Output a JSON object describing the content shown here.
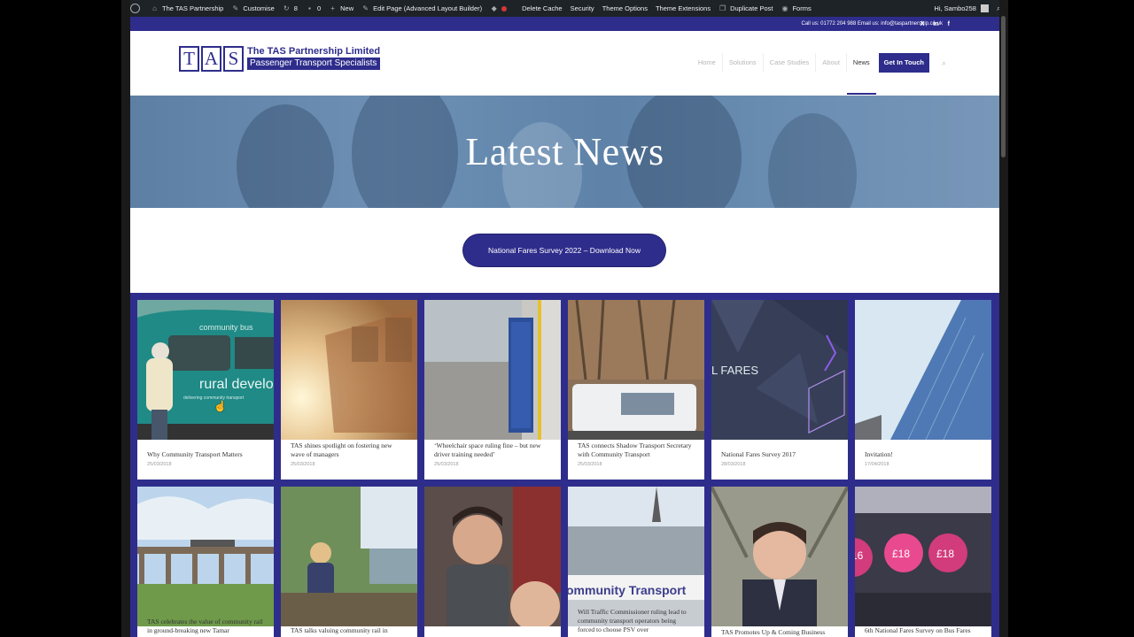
{
  "adminbar": {
    "site_name": "The TAS Partnership",
    "customise": "Customise",
    "updates_count": "8",
    "comments_count": "0",
    "new": "New",
    "edit_page": "Edit Page (Advanced Layout Builder)",
    "delete_cache": "Delete Cache",
    "security": "Security",
    "theme_options": "Theme Options",
    "theme_extensions": "Theme Extensions",
    "duplicate_post": "Duplicate Post",
    "forms": "Forms",
    "greeting": "Hi, Sambo258"
  },
  "topbar": {
    "contact": "Call us: 01772 204 988 Email us: info@taspartnership.co.uk",
    "social_x": "X",
    "social_linkedin": "in",
    "social_facebook": "f"
  },
  "logo": {
    "letters": [
      "T",
      "A",
      "S"
    ],
    "name": "The TAS Partnership Limited",
    "tagline": "Passenger Transport Specialists"
  },
  "nav": {
    "items": [
      "Home",
      "Solutions",
      "Case Studies",
      "About",
      "News"
    ],
    "active": "News",
    "cta": "Get In Touch"
  },
  "hero": {
    "title": "Latest News"
  },
  "download": {
    "label": "National Fares Survey 2022 – Download Now"
  },
  "posts": [
    {
      "title": "Why Community Transport Matters",
      "date": "25/03/2018",
      "image": "community-bus"
    },
    {
      "title": "TAS shines spotlight on fostering new wave of managers",
      "date": "25/03/2018",
      "image": "bus-sunlight"
    },
    {
      "title": "‘Wheelchair space ruling fine – but new driver training needed’",
      "date": "25/03/2018",
      "image": "bus-interior"
    },
    {
      "title": "TAS connects Shadow Transport Secretary with Community Transport",
      "date": "25/03/2018",
      "image": "minibus-trees"
    },
    {
      "title": "National Fares Survey 2017",
      "date": "28/03/2018",
      "image": "fares-graphic"
    },
    {
      "title": "Invitation!",
      "date": "17/04/2018",
      "image": "skyscraper"
    },
    {
      "title": "TAS celebrates the value of community rail in ground-breaking new Tamar",
      "date": "",
      "image": "viaduct"
    },
    {
      "title": "TAS talks valuing community rail in",
      "date": "",
      "image": "woman-river"
    },
    {
      "title": "",
      "date": "",
      "image": "boy-train"
    },
    {
      "title": "Will Traffic Commissioner ruling lead to community transport operators being forced to choose PSV over",
      "date": "",
      "image": "community-transport-sign"
    },
    {
      "title": "TAS Promotes Up & Coming Business",
      "date": "",
      "image": "man-portrait"
    },
    {
      "title": "6th National Fares Survey on Bus Fares",
      "date": "",
      "image": "fares-prices"
    }
  ],
  "image_text": {
    "bus_line1": "community bus",
    "bus_line2": "rural develo",
    "bus_line3": "delivering community transport",
    "fares_text": "L FARES",
    "ct_sign": "ommunity Transport",
    "price1": "£18",
    "price2": "£18",
    "price3": "16"
  }
}
